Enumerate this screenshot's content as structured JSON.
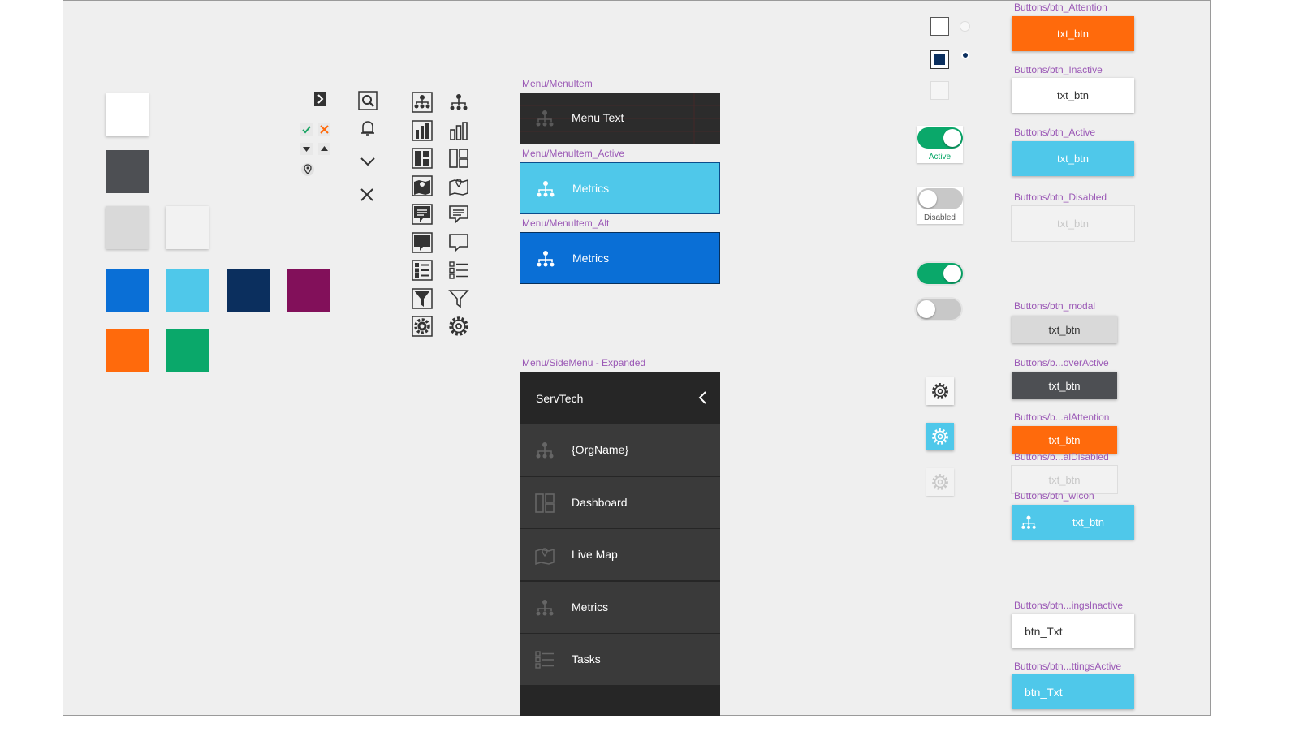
{
  "colors": {
    "white": "#ffffff",
    "dark_gray": "#4d4f53",
    "light_gray": "#d9d9d9",
    "off_white": "#f2f2f2",
    "blue": "#0a6fd6",
    "light_blue": "#4fc8ea",
    "navy": "#0b2f5e",
    "purple": "#82105a",
    "orange": "#ff6a0c",
    "green": "#0aa86a"
  },
  "menu": {
    "item_label": "Menu/MenuItem",
    "item_text": "Menu Text",
    "active_label": "Menu/MenuItem_Active",
    "active_text": "Metrics",
    "alt_label": "Menu/MenuItem_Alt",
    "alt_text": "Metrics",
    "side_label": "Menu/SideMenu - Expanded"
  },
  "sidemenu": {
    "title": "ServTech",
    "items": [
      {
        "label": "{OrgName}",
        "icon": "org-chart-icon"
      },
      {
        "label": "Dashboard",
        "icon": "dashboard-icon"
      },
      {
        "label": "Live Map",
        "icon": "map-icon"
      },
      {
        "label": "Metrics",
        "icon": "org-chart-icon"
      },
      {
        "label": "Tasks",
        "icon": "list-icon"
      }
    ]
  },
  "toggles": {
    "active_label": "Active",
    "disabled_label": "Disabled"
  },
  "buttons": {
    "attention_label": "Buttons/btn_Attention",
    "attention_text": "txt_btn",
    "inactive_label": "Buttons/btn_Inactive",
    "inactive_text": "txt_btn",
    "active_label": "Buttons/btn_Active",
    "active_text": "txt_btn",
    "disabled_label": "Buttons/btn_Disabled",
    "disabled_text": "txt_btn",
    "modal_label": "Buttons/btn_modal",
    "modal_text": "txt_btn",
    "hover_label": "Buttons/b...overActive",
    "hover_text": "txt_btn",
    "modal_attention_label": "Buttons/b...alAttention",
    "modal_attention_text": "txt_btn",
    "modal_disabled_label": "Buttons/b...alDisabled",
    "modal_disabled_text": "txt_btn",
    "icon_label": "Buttons/btn_wIcon",
    "icon_text": "txt_btn",
    "settings_inactive_label": "Buttons/btn...ingsInactive",
    "settings_inactive_text": "btn_Txt",
    "settings_active_label": "Buttons/btn...ttingsActive",
    "settings_active_text": "btn_Txt"
  }
}
